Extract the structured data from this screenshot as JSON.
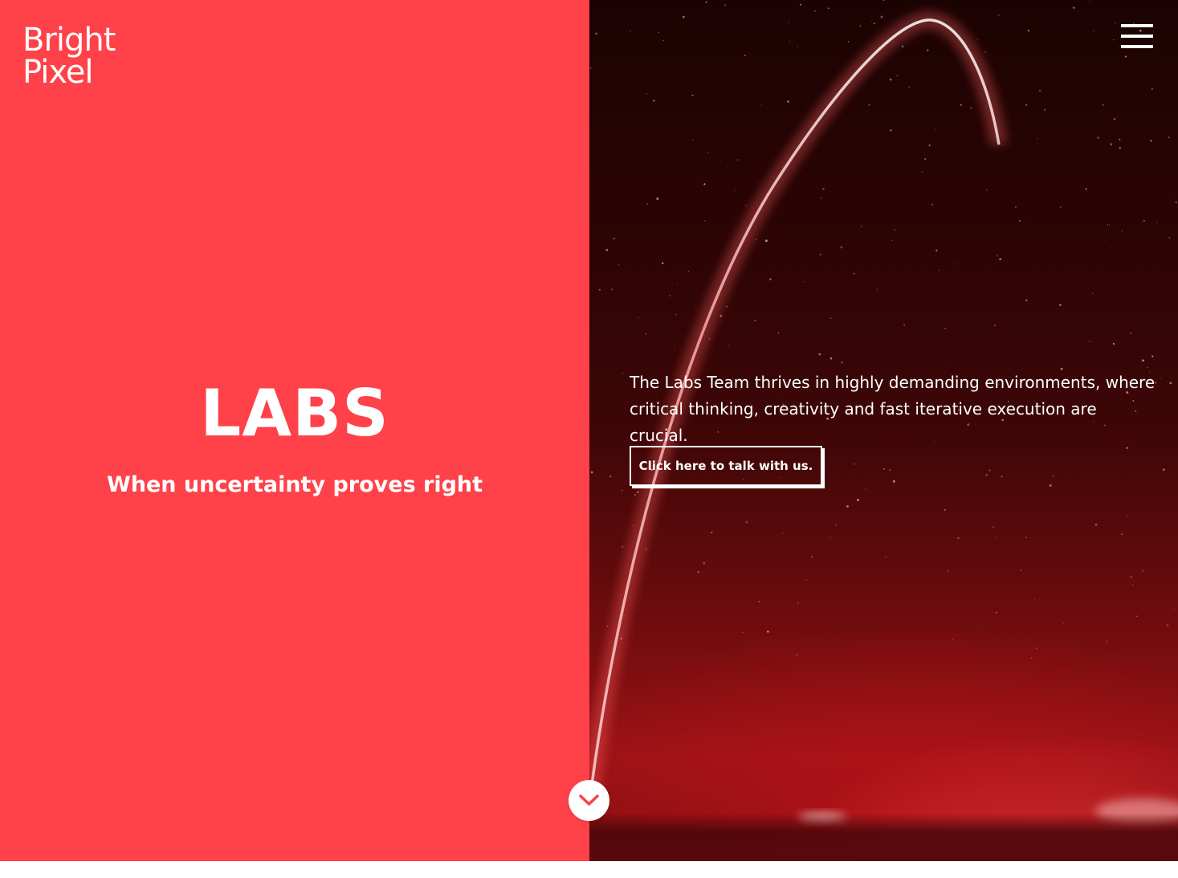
{
  "brand": {
    "logo_line1": "Bright",
    "logo_line2": "Pixel"
  },
  "hero": {
    "title": "LABS",
    "subtitle": "When uncertainty proves right",
    "description": "The Labs Team thrives in highly demanding environments, where critical thinking, creativity and fast iterative execution are crucial.",
    "cta_label": "Click here to talk with us."
  },
  "icons": {
    "menu": "hamburger-menu-icon",
    "scroll": "chevron-down-icon"
  },
  "colors": {
    "left_panel": "#ff4149",
    "accent": "#ff4149",
    "text": "#ffffff"
  }
}
